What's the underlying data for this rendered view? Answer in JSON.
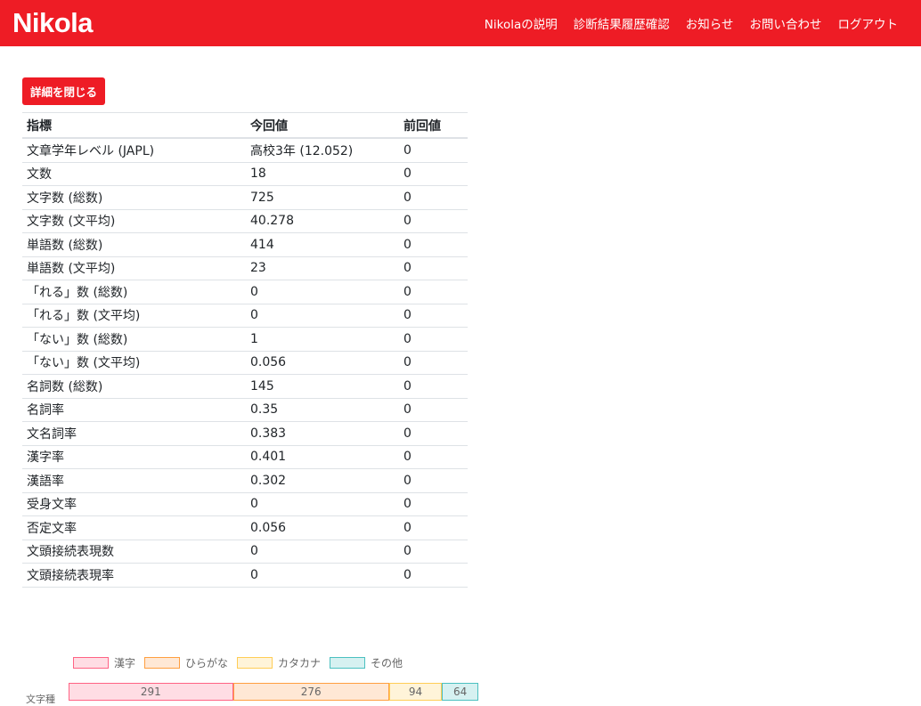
{
  "nav": {
    "brand": "Nikola",
    "links": [
      "Nikolaの説明",
      "診断結果履歴確認",
      "お知らせ",
      "お問い合わせ",
      "ログアウト"
    ]
  },
  "close_button_label": "詳細を閉じる",
  "table": {
    "headers": [
      "指標",
      "今回値",
      "前回値"
    ],
    "rows": [
      [
        "文章学年レベル (JAPL)",
        "高校3年 (12.052)",
        "0"
      ],
      [
        "文数",
        "18",
        "0"
      ],
      [
        "文字数 (総数)",
        "725",
        "0"
      ],
      [
        "文字数 (文平均)",
        "40.278",
        "0"
      ],
      [
        "単語数 (総数)",
        "414",
        "0"
      ],
      [
        "単語数 (文平均)",
        "23",
        "0"
      ],
      [
        "「れる」数 (総数)",
        "0",
        "0"
      ],
      [
        "「れる」数 (文平均)",
        "0",
        "0"
      ],
      [
        "「ない」数 (総数)",
        "1",
        "0"
      ],
      [
        "「ない」数 (文平均)",
        "0.056",
        "0"
      ],
      [
        "名詞数 (総数)",
        "145",
        "0"
      ],
      [
        "名詞率",
        "0.35",
        "0"
      ],
      [
        "文名詞率",
        "0.383",
        "0"
      ],
      [
        "漢字率",
        "0.401",
        "0"
      ],
      [
        "漢語率",
        "0.302",
        "0"
      ],
      [
        "受身文率",
        "0",
        "0"
      ],
      [
        "否定文率",
        "0.056",
        "0"
      ],
      [
        "文頭接続表現数",
        "0",
        "0"
      ],
      [
        "文頭接続表現率",
        "0",
        "0"
      ]
    ]
  },
  "chart_data": {
    "type": "bar",
    "orientation": "horizontal",
    "stacked": true,
    "categories": [
      "文字種"
    ],
    "series": [
      {
        "name": "漢字",
        "values": [
          291
        ],
        "fill": "#ffdde4",
        "stroke": "#ff6384"
      },
      {
        "name": "ひらがな",
        "values": [
          276
        ],
        "fill": "#ffe8d5",
        "stroke": "#ff9f40"
      },
      {
        "name": "カタカナ",
        "values": [
          94
        ],
        "fill": "#fff4d9",
        "stroke": "#ffcd56"
      },
      {
        "name": "その他",
        "values": [
          64
        ],
        "fill": "#d6f1f1",
        "stroke": "#4bc0c0"
      }
    ],
    "legend": "top"
  }
}
